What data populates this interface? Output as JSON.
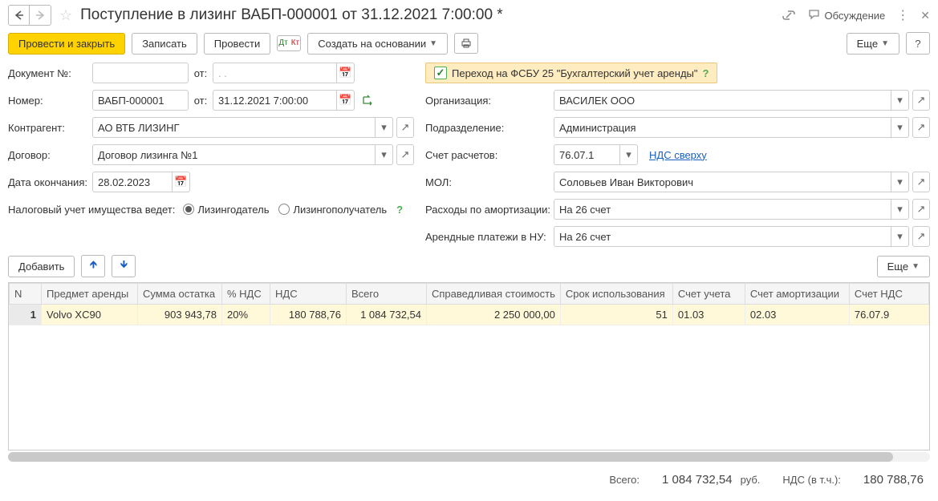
{
  "title": "Поступление в лизинг ВАБП-000001 от 31.12.2021 7:00:00 *",
  "top_right": {
    "discuss": "Обсуждение"
  },
  "toolbar": {
    "post_close": "Провести и закрыть",
    "write": "Записать",
    "post": "Провести",
    "create_based": "Создать на основании",
    "more": "Еще"
  },
  "form": {
    "doc_no_label": "Документ №:",
    "doc_no_value": "",
    "from_label": "от:",
    "doc_date_value": " .  .    ",
    "number_label": "Номер:",
    "number_value": "ВАБП-000001",
    "number_date": "31.12.2021  7:00:00",
    "counterparty_label": "Контрагент:",
    "counterparty_value": "АО ВТБ ЛИЗИНГ",
    "contract_label": "Договор:",
    "contract_value": "Договор лизинга №1",
    "end_date_label": "Дата окончания:",
    "end_date_value": "28.02.2023",
    "tax_label": "Налоговый учет имущества ведет:",
    "tax_opt1": "Лизингодатель",
    "tax_opt2": "Лизингополучатель",
    "fsbu_text": "Переход на ФСБУ 25 \"Бухгалтерский учет аренды\"",
    "org_label": "Организация:",
    "org_value": "ВАСИЛЕК ООО",
    "dept_label": "Подразделение:",
    "dept_value": "Администрация",
    "account_label": "Счет расчетов:",
    "account_value": "76.07.1",
    "vat_link": "НДС сверху",
    "mol_label": "МОЛ:",
    "mol_value": "Соловьев Иван Викторович",
    "depr_label": "Расходы по амортизации:",
    "depr_value": "На 26 счет",
    "rent_label": "Арендные платежи в НУ:",
    "rent_value": "На 26 счет"
  },
  "table_toolbar": {
    "add": "Добавить",
    "more": "Еще"
  },
  "table": {
    "headers": {
      "n": "N",
      "subject": "Предмет аренды",
      "balance": "Сумма остатка",
      "vat_pct": "% НДС",
      "vat": "НДС",
      "total": "Всего",
      "fair_value": "Справедливая стоимость",
      "use_term": "Срок использования",
      "acc": "Счет учета",
      "acc_depr": "Счет амортизации",
      "acc_vat": "Счет НДС"
    },
    "rows": [
      {
        "n": "1",
        "subject": "Volvo XC90",
        "balance": "903 943,78",
        "vat_pct": "20%",
        "vat": "180 788,76",
        "total": "1 084 732,54",
        "fair_value": "2 250 000,00",
        "use_term": "51",
        "acc": "01.03",
        "acc_depr": "02.03",
        "acc_vat": "76.07.9"
      }
    ]
  },
  "footer": {
    "total_lbl": "Всего:",
    "total_val": "1 084 732,54",
    "cur": "руб.",
    "vat_lbl": "НДС (в т.ч.):",
    "vat_val": "180 788,76"
  }
}
